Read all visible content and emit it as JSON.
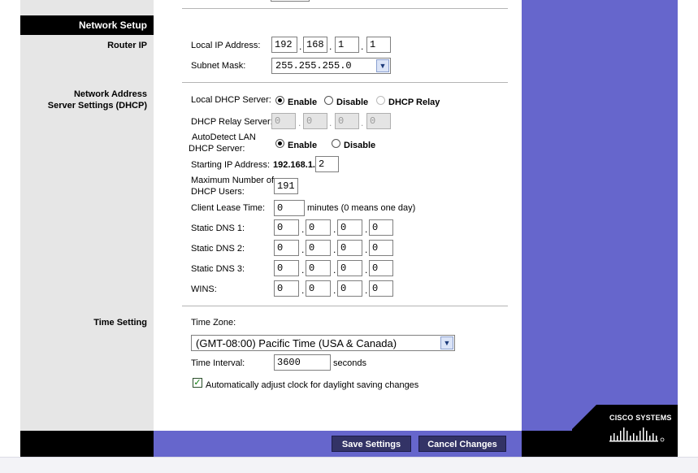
{
  "sidebar": {
    "header": "Network Setup",
    "router_ip": "Router IP",
    "dhcp_line1": "Network Address",
    "dhcp_line2": "Server Settings (DHCP)",
    "time_setting": "Time Setting"
  },
  "router_ip": {
    "local_ip_label": "Local IP Address:",
    "ip": [
      "192",
      "168",
      "1",
      "1"
    ],
    "subnet_label": "Subnet Mask:",
    "subnet_value": "255.255.255.0"
  },
  "dhcp": {
    "server_label": "Local DHCP Server:",
    "enable": "Enable",
    "disable": "Disable",
    "relay": "DHCP Relay",
    "relay_server_label": "DHCP Relay Server:",
    "relay_ip": [
      "0",
      "0",
      "0",
      "0"
    ],
    "autodetect_label_1": "AutoDetect LAN",
    "autodetect_label_2": "DHCP Server:",
    "auto_enable": "Enable",
    "auto_disable": "Disable",
    "start_ip_label": "Starting IP Address:",
    "start_ip_prefix": "192.168.1.",
    "start_ip_last": "2",
    "max_users_label_1": "Maximum Number of",
    "max_users_label_2": "DHCP Users:",
    "max_users": "191",
    "lease_label": "Client Lease Time:",
    "lease_value": "0",
    "lease_suffix": "minutes (0 means one day)",
    "dns1_label": "Static DNS 1:",
    "dns1": [
      "0",
      "0",
      "0",
      "0"
    ],
    "dns2_label": "Static DNS 2:",
    "dns2": [
      "0",
      "0",
      "0",
      "0"
    ],
    "dns3_label": "Static DNS 3:",
    "dns3": [
      "0",
      "0",
      "0",
      "0"
    ],
    "wins_label": "WINS:",
    "wins": [
      "0",
      "0",
      "0",
      "0"
    ]
  },
  "time": {
    "zone_label": "Time Zone:",
    "zone_value": "(GMT-08:00) Pacific Time (USA & Canada)",
    "interval_label": "Time Interval:",
    "interval_value": "3600",
    "interval_suffix": "seconds",
    "dst_label": "Automatically adjust clock for daylight saving changes"
  },
  "buttons": {
    "save": "Save Settings",
    "cancel": "Cancel Changes"
  },
  "brand": {
    "name": "Cisco Systems",
    "name_display": "CISCO SYSTEMS"
  },
  "colors": {
    "accent_purple": "#6666cc",
    "button": "#333366"
  }
}
